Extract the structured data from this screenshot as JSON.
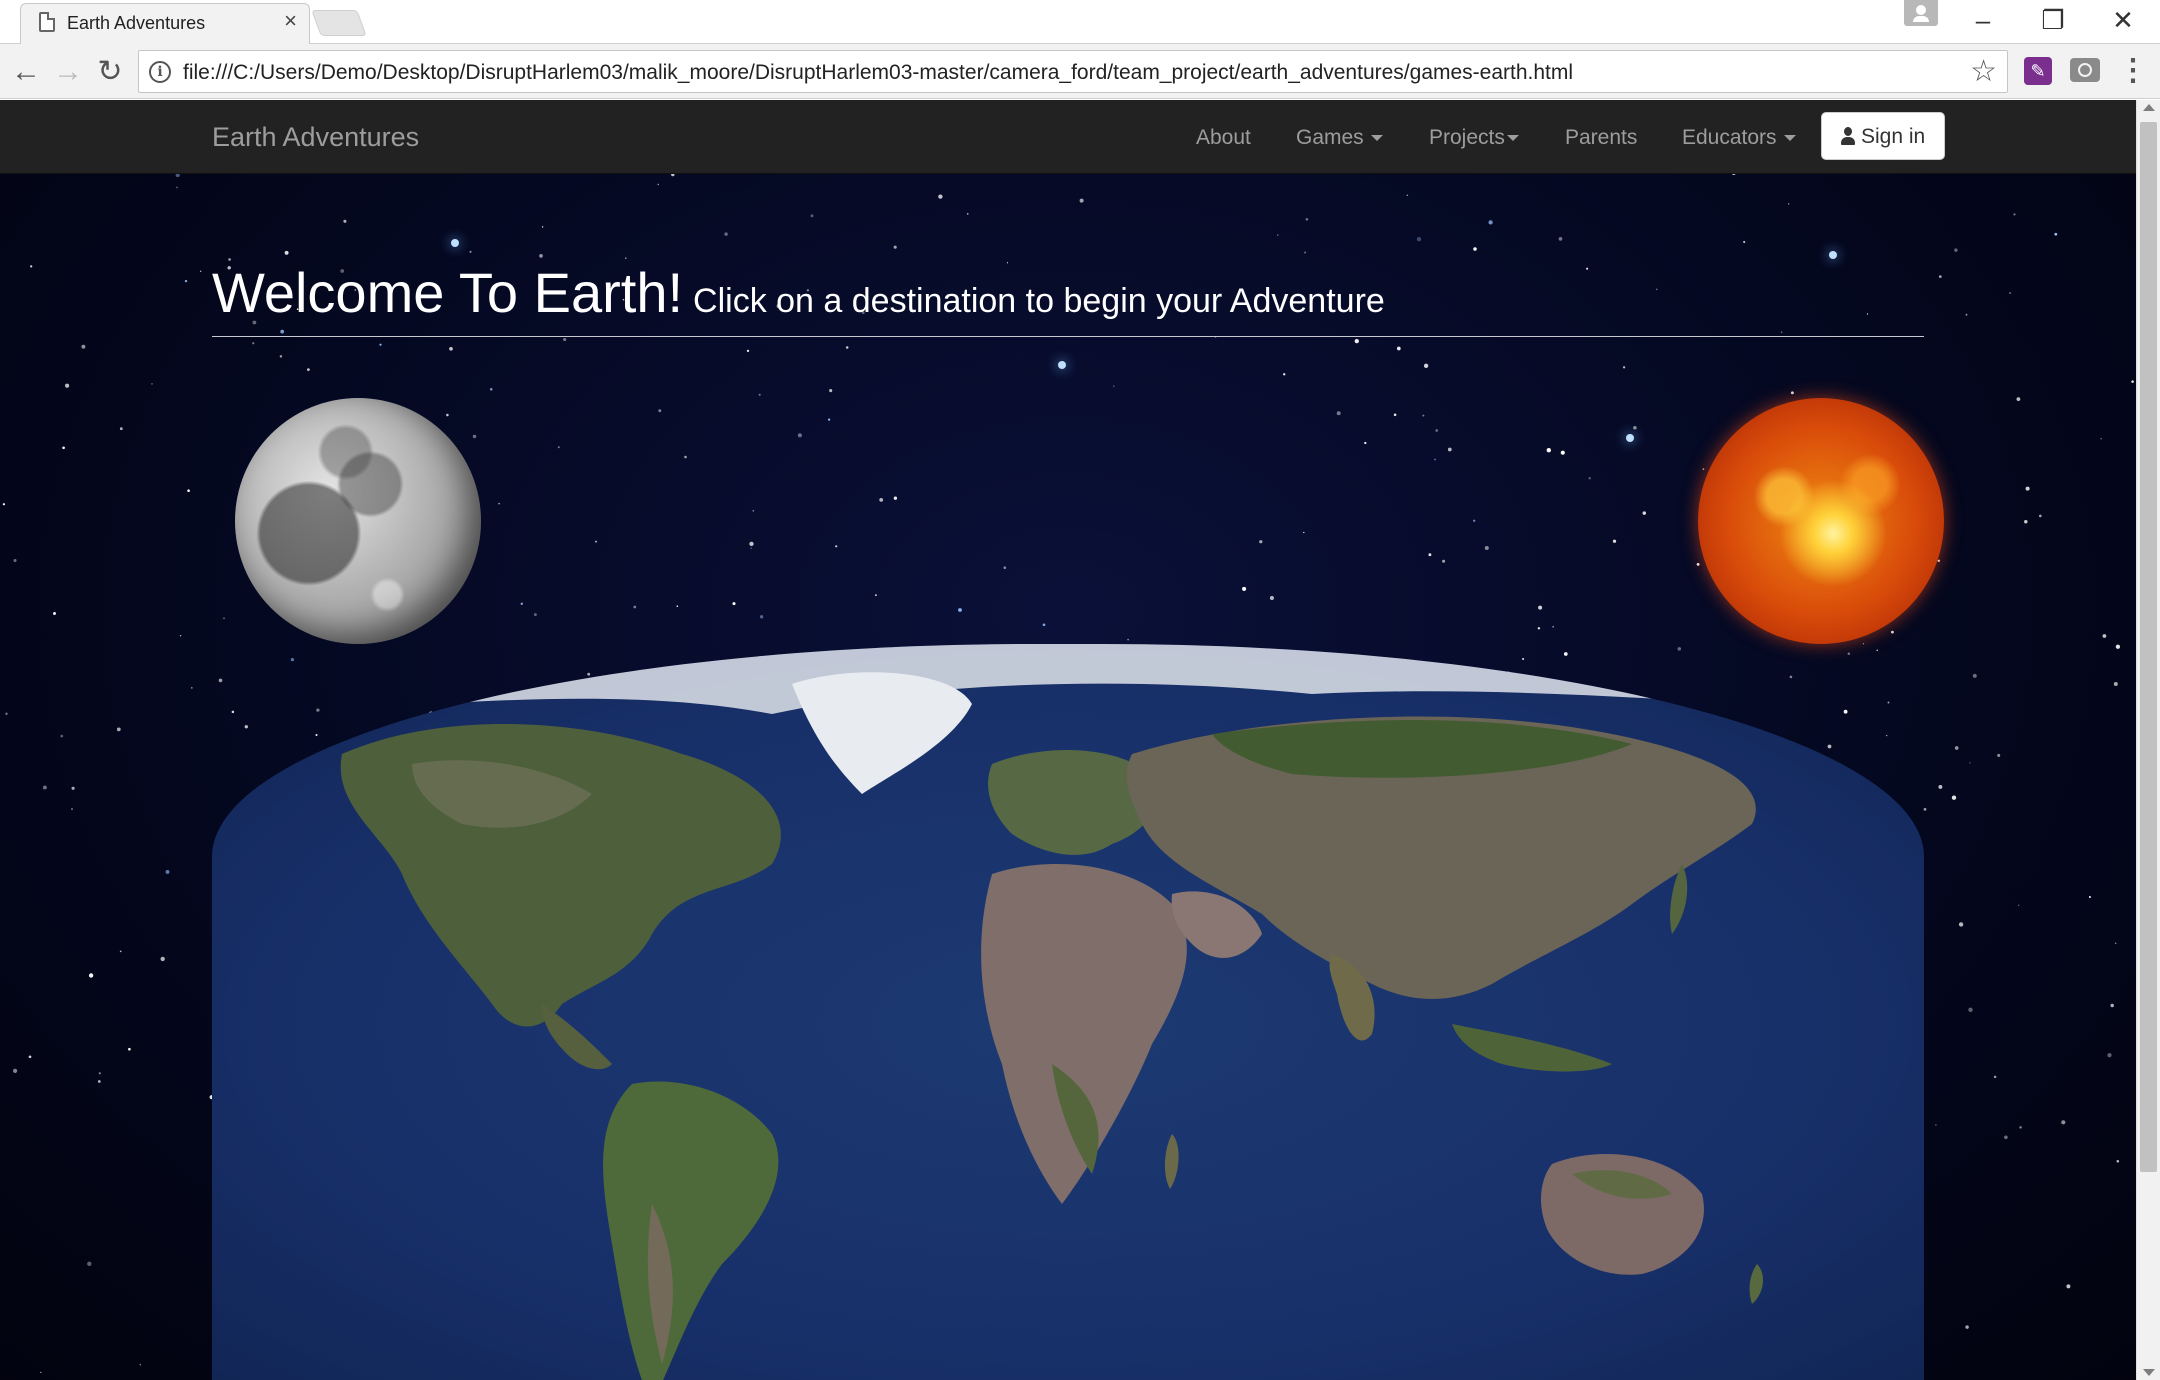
{
  "browser": {
    "tab_title": "Earth Adventures",
    "tab_close": "×",
    "url": "file:///C:/Users/Demo/Desktop/DisruptHarlem03/malik_moore/DisruptHarlem03-master/camera_ford/team_project/earth_adventures/games-earth.html",
    "icons": [
      "document-icon",
      "back-icon",
      "forward-icon",
      "reload-icon",
      "info-icon",
      "bookmark-star-icon",
      "extension-icon",
      "camera-icon",
      "menu-icon",
      "profile-icon",
      "minimize-icon",
      "restore-icon",
      "close-icon"
    ]
  },
  "navbar": {
    "brand": "Earth Adventures",
    "links": [
      {
        "label": "About",
        "dropdown": false
      },
      {
        "label": "Games",
        "dropdown": true
      },
      {
        "label": "Projects",
        "dropdown": true
      },
      {
        "label": "Parents",
        "dropdown": false
      },
      {
        "label": "Educators",
        "dropdown": true
      }
    ],
    "signin_label": "Sign in"
  },
  "hero": {
    "title": "Welcome To Earth!",
    "subtitle": "Click on a destination to begin your Adventure"
  },
  "destinations": [
    "moon",
    "sun",
    "earth-map"
  ],
  "colors": {
    "navbar_bg": "#222222",
    "navbar_text": "#9d9d9d",
    "space_bg": "#040820",
    "ocean": "#1d3a72"
  }
}
